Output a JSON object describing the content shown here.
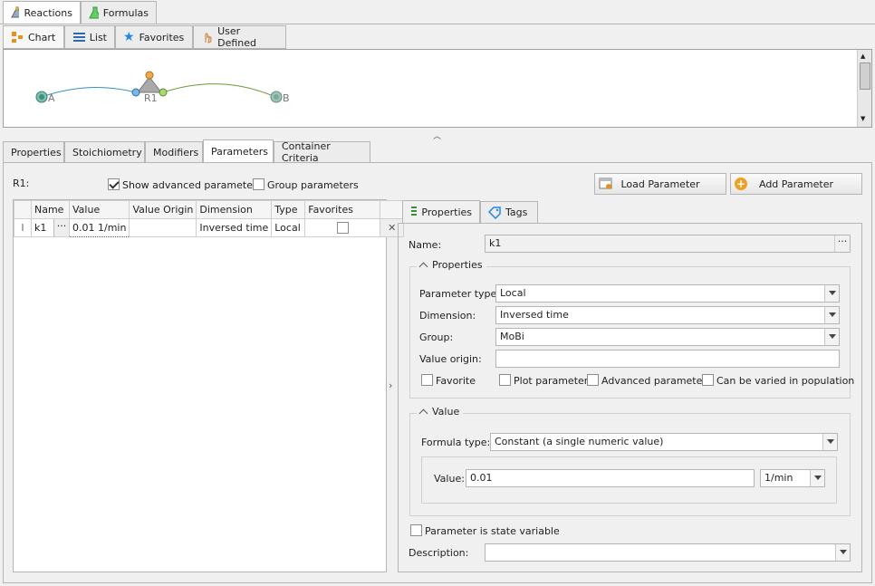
{
  "top_tabs": [
    {
      "label": "Reactions",
      "icon": "reactions-icon"
    },
    {
      "label": "Formulas",
      "icon": "flask-icon"
    }
  ],
  "view_tabs": [
    {
      "label": "Chart",
      "icon": "chart-icon"
    },
    {
      "label": "List",
      "icon": "list-icon"
    },
    {
      "label": "Favorites",
      "icon": "star-icon"
    },
    {
      "label": "User Defined",
      "icon": "hand-icon"
    }
  ],
  "diagram": {
    "nodes": [
      "A",
      "R1",
      "B"
    ]
  },
  "detail_tabs": [
    "Properties",
    "Stoichiometry",
    "Modifiers",
    "Parameters",
    "Container Criteria"
  ],
  "reaction_label": "R1:",
  "show_advanced_label": "Show advanced parameters",
  "group_params_label": "Group parameters",
  "load_button": "Load Parameter",
  "add_button": "Add Parameter",
  "grid": {
    "columns": [
      "Name",
      "Value",
      "Value Origin",
      "Dimension",
      "Type",
      "Favorites"
    ],
    "rows": [
      {
        "name": "k1",
        "value": "0.01 1/min",
        "origin": "",
        "dimension": "Inversed time",
        "type": "Local",
        "favorite": false
      }
    ]
  },
  "right_tabs": [
    "Properties",
    "Tags"
  ],
  "form": {
    "name_label": "Name:",
    "name_value": "k1",
    "properties_header": "Properties",
    "param_type_label": "Parameter type:",
    "param_type_value": "Local",
    "dimension_label": "Dimension:",
    "dimension_value": "Inversed time",
    "group_label": "Group:",
    "group_value": "MoBi",
    "value_origin_label": "Value origin:",
    "value_origin_value": "",
    "favorite_label": "Favorite",
    "plot_label": "Plot parameter",
    "advanced_label": "Advanced parameter",
    "varied_label": "Can be varied in population",
    "value_header": "Value",
    "formula_type_label": "Formula type:",
    "formula_type_value": "Constant (a single numeric value)",
    "value_label": "Value:",
    "value_value": "0.01",
    "unit_value": "1/min",
    "state_var_label": "Parameter is state variable",
    "description_label": "Description:",
    "description_value": ""
  },
  "colors": {
    "accent": "#2b6cb0",
    "node": "#5fa89a",
    "reaction": "#a0a0a0",
    "edge_left": "#3a8fc0",
    "edge_right": "#6a9a3a"
  }
}
